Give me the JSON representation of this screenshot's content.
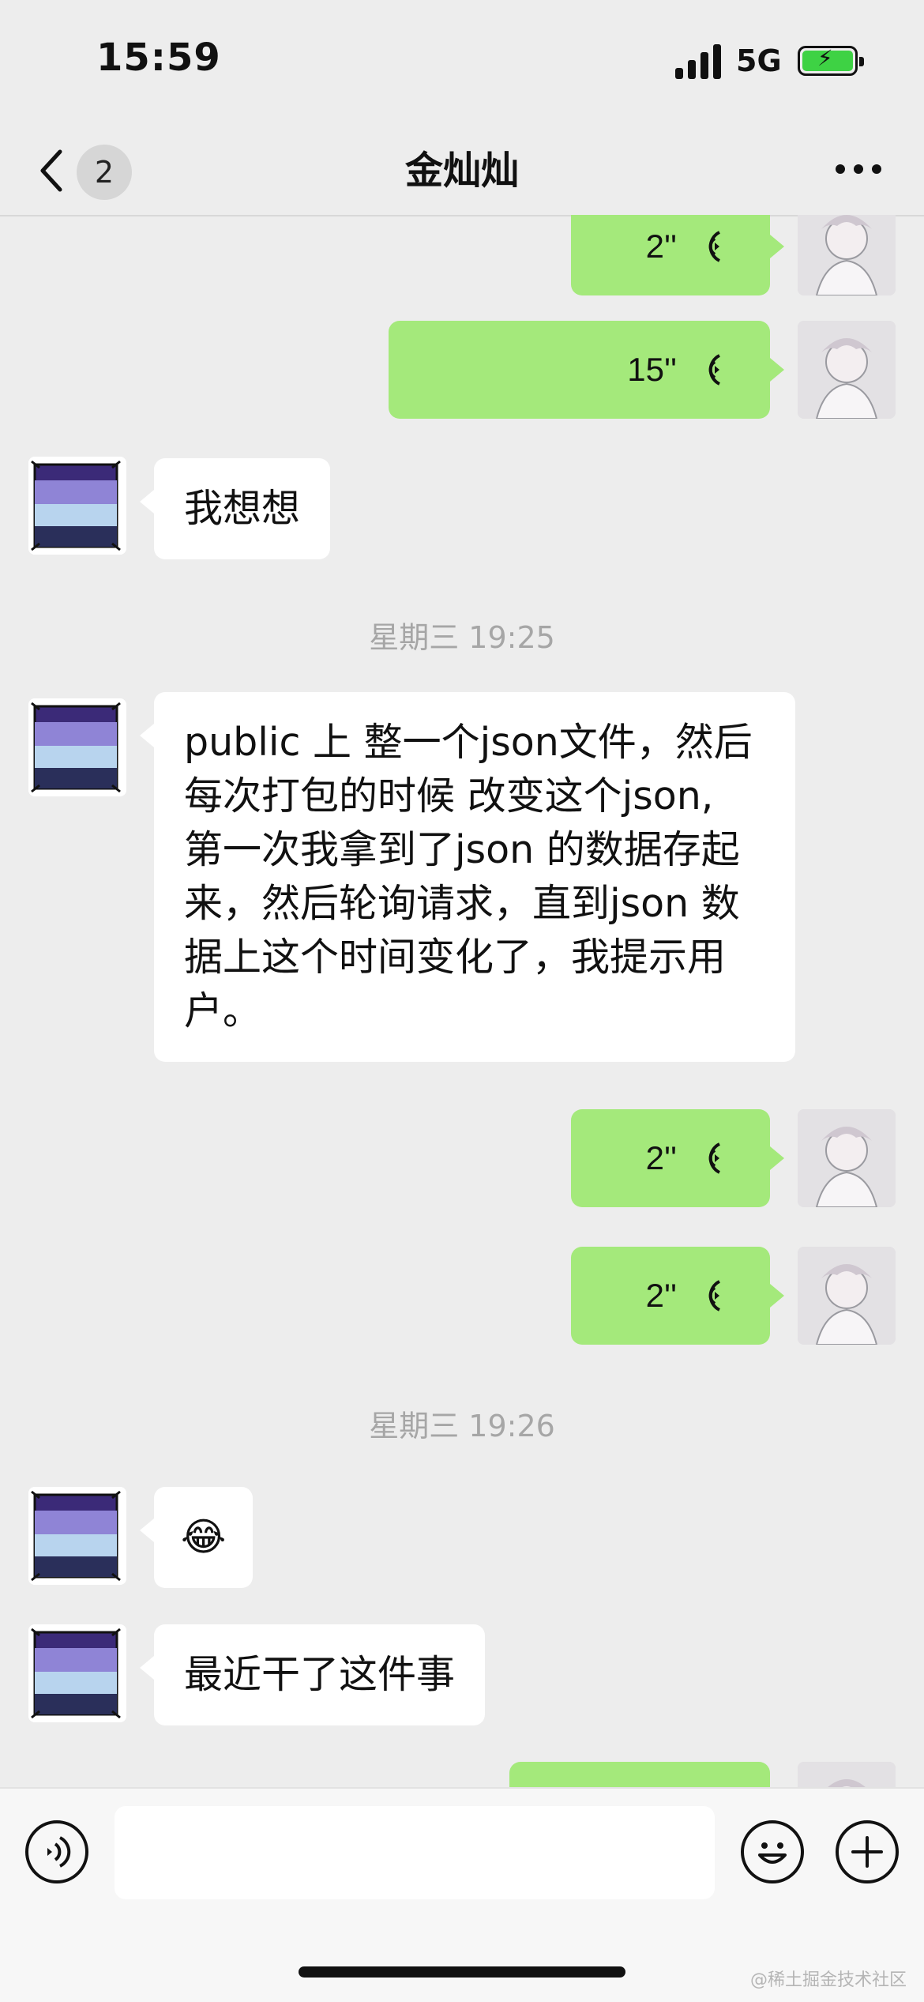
{
  "status_bar": {
    "time": "15:59",
    "network": "5G",
    "battery_level": 1.0
  },
  "nav": {
    "unread_count": "2",
    "title": "金灿灿"
  },
  "messages": [
    {
      "side": "right",
      "type": "voice",
      "duration": "2''"
    },
    {
      "side": "right",
      "type": "voice",
      "duration": "15''"
    },
    {
      "side": "left",
      "type": "text",
      "text": "我想想"
    },
    {
      "type": "timestamp",
      "text": "星期三 19:25"
    },
    {
      "side": "left",
      "type": "text",
      "lines": [
        "public 上 整一个json文件，然后",
        "每次打包的时候 改变这个json,",
        "第一次我拿到了json 的数据存起",
        "来，然后轮询请求，直到json 数",
        "据上这个时间变化了，我提示用",
        "户。"
      ]
    },
    {
      "side": "right",
      "type": "voice",
      "duration": "2''"
    },
    {
      "side": "right",
      "type": "voice",
      "duration": "2''"
    },
    {
      "type": "timestamp",
      "text": "星期三 19:26"
    },
    {
      "side": "left",
      "type": "emoji",
      "text": "😂"
    },
    {
      "side": "left",
      "type": "text",
      "text": "最近干了这件事"
    },
    {
      "side": "right",
      "type": "voice",
      "duration": ""
    }
  ],
  "input_bar": {
    "placeholder": ""
  },
  "watermark": "@稀土掘金技术社区",
  "colors": {
    "background": "#ededed",
    "sent_bubble": "#a4e97b",
    "received_bubble": "#ffffff",
    "timestamp": "#a6a6a6"
  },
  "icons": [
    "back-chevron-icon",
    "more-dots-icon",
    "voice-wave-icon",
    "voice-toggle-icon",
    "emoji-face-icon",
    "plus-icon",
    "signal-bars-icon",
    "battery-charging-icon"
  ]
}
